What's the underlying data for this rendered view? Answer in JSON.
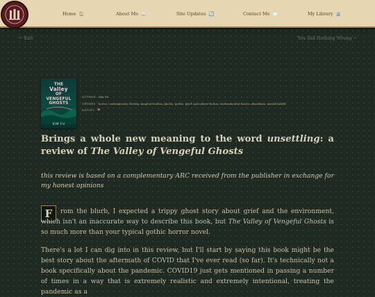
{
  "nav": {
    "items": [
      {
        "label": "Home",
        "icon": "🏠"
      },
      {
        "label": "About Me",
        "icon": "📖"
      },
      {
        "label": "Site Updates",
        "icon": "🔄"
      },
      {
        "label": "Contact Me",
        "icon": "✉️"
      },
      {
        "label": "My Library",
        "icon": "🏛️"
      }
    ]
  },
  "pager": {
    "prev": "← Exit",
    "next": "You Did Nothing Wrong →"
  },
  "book": {
    "cover_title_1": "THE",
    "cover_title_2": "Valley",
    "cover_title_3": "OF",
    "cover_title_4": "VENGEFUL",
    "cover_title_5": "GHOSTS",
    "cover_author": "KIM FU",
    "author_label": "AUTHOR",
    "author": "Kim Fu",
    "genres_label": "GENRES",
    "genres": "horror, contemporary, literary, magical realism, ghosts, gothic, grief, speculative fiction, environmental horror, absurdism, mental health",
    "rating_label": "RATING",
    "rating_icon": "heart-icon",
    "rating": "♥"
  },
  "post": {
    "title_a": "Brings a whole new meaning to the word ",
    "title_b": "unsettling",
    "title_c": ": a review of ",
    "title_d": "The Valley of Vengeful Ghosts",
    "intro": "this review is based on a complementary ARC received from the publisher in exchange for my honest opinions",
    "dropcap": "F",
    "p1_a": "rom the blurb, I expected a trippy ghost story about grief and the environment, which isn't an inaccurate way to describe this book, but ",
    "p1_b": "The Valley of Vengeful Ghosts",
    "p1_c": " is so much more than your typical gothic horror novel.",
    "p2": "There's a lot I can dig into in this review, but I'll start by saying this book might be the best story about the aftermath of COVID that I've ever read (so far). It's technically not a book specifically about the pandemic. COVID19 just gets mentioned in passing a number of times in a way that is extremely realistic and extremely intentional, treating the pandemic as a"
  },
  "colors": {
    "background": "#1f2a22",
    "topbar": "#e7d6b2",
    "logo": "#5a1c22",
    "accent": "#d6c89a"
  }
}
